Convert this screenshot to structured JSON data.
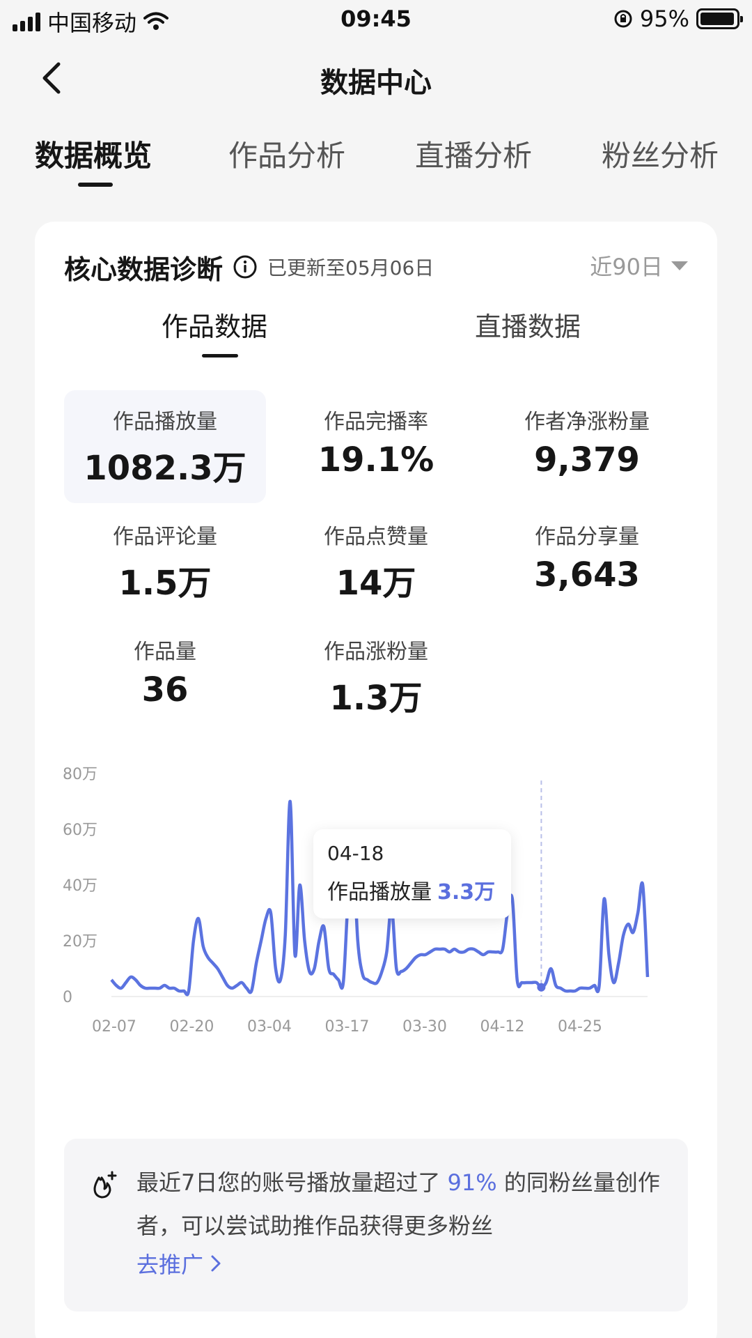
{
  "status_bar": {
    "carrier": "中国移动",
    "time": "09:45",
    "battery": "95%",
    "battery_level": 0.95
  },
  "nav": {
    "title": "数据中心",
    "back_icon": "chevron-left-icon"
  },
  "top_tabs": [
    {
      "label": "数据概览",
      "active": true
    },
    {
      "label": "作品分析",
      "active": false
    },
    {
      "label": "直播分析",
      "active": false
    },
    {
      "label": "粉丝分析",
      "active": false
    }
  ],
  "card": {
    "title": "核心数据诊断",
    "updated": "已更新至05月06日",
    "range": "近90日",
    "sub_tabs": [
      {
        "label": "作品数据",
        "active": true
      },
      {
        "label": "直播数据",
        "active": false
      }
    ],
    "metrics": [
      {
        "label": "作品播放量",
        "value": "1082.3万",
        "selected": true
      },
      {
        "label": "作品完播率",
        "value": "19.1%"
      },
      {
        "label": "作者净涨粉量",
        "value": "9,379"
      },
      {
        "label": "作品评论量",
        "value": "1.5万"
      },
      {
        "label": "作品点赞量",
        "value": "14万"
      },
      {
        "label": "作品分享量",
        "value": "3,643"
      },
      {
        "label": "作品量",
        "value": "36"
      },
      {
        "label": "作品涨粉量",
        "value": "1.3万"
      }
    ]
  },
  "chart_data": {
    "type": "line",
    "ylim": [
      0,
      80
    ],
    "y_ticks": [
      0,
      20,
      40,
      60,
      80
    ],
    "y_tick_labels": [
      "0",
      "20万",
      "40万",
      "60万",
      "80万"
    ],
    "x_tick_labels": [
      "02-07",
      "02-20",
      "03-04",
      "03-17",
      "03-30",
      "04-12",
      "04-25"
    ],
    "series": [
      {
        "values": [
          6,
          4,
          3,
          5,
          7,
          6,
          4,
          3,
          3,
          3,
          3,
          4,
          3,
          3,
          2,
          2,
          2,
          20,
          28,
          18,
          14,
          12,
          10,
          7,
          4,
          3,
          4,
          5,
          3,
          2,
          12,
          20,
          28,
          30,
          10,
          6,
          22,
          70,
          15,
          40,
          20,
          9,
          10,
          20,
          25,
          10,
          8,
          6,
          5,
          35,
          52,
          20,
          8,
          6,
          5,
          5,
          9,
          16,
          32,
          10,
          9,
          10,
          12,
          14,
          15,
          15,
          16,
          17,
          17,
          17,
          16,
          17,
          16,
          16,
          17,
          17,
          16,
          15,
          16,
          16,
          16,
          17,
          30,
          35,
          6,
          5,
          5,
          5,
          5,
          3.3,
          5,
          10,
          4,
          3,
          2,
          2,
          2,
          3,
          3,
          3,
          4,
          4,
          35,
          15,
          5,
          12,
          22,
          26,
          23,
          30,
          40,
          7
        ]
      }
    ],
    "tooltip": {
      "date": "04-18",
      "label": "作品播放量",
      "value": "3.3万",
      "index": 89
    }
  },
  "colors": {
    "accent": "#5b6fde",
    "line": "#5b73e0"
  },
  "tip": {
    "icon": "fire-plus-icon",
    "text_before": "最近7日您的账号播放量超过了",
    "highlight": "91%",
    "text_after": "的同粉丝量创作者，可以尝试助推作品获得更多粉丝",
    "link_label": "去推广"
  }
}
